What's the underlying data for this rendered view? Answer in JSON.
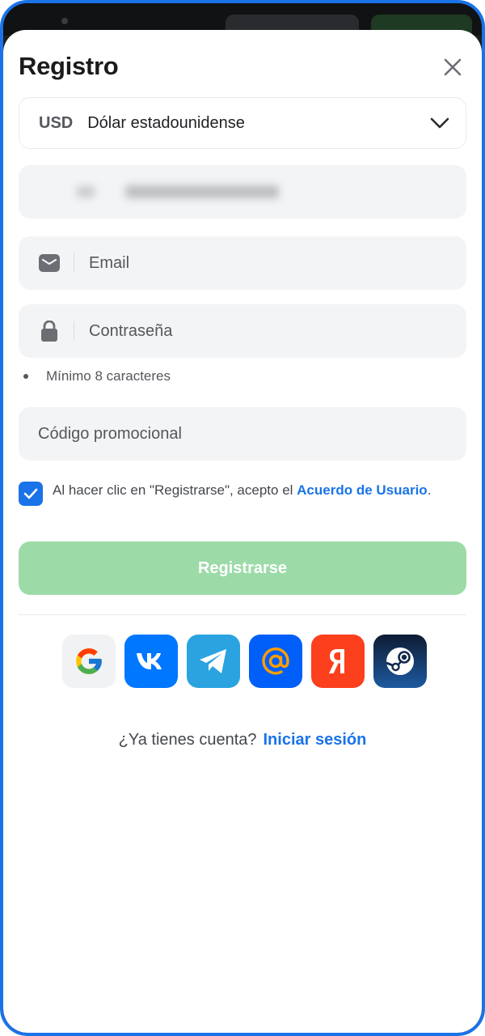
{
  "header": {
    "title": "Registro"
  },
  "currency": {
    "code": "USD",
    "name": "Dólar estadounidense"
  },
  "form": {
    "email_placeholder": "Email",
    "password_placeholder": "Contraseña",
    "password_hint": "Mínimo 8 caracteres",
    "promo_placeholder": "Código promocional"
  },
  "agreement": {
    "checked": true,
    "text": "Al hacer clic en \"Registrarse\", acepto el ",
    "link": "Acuerdo de Usuario",
    "suffix": "."
  },
  "register_button": "Registrarse",
  "social": [
    {
      "name": "google-icon",
      "color": "#f1f2f4"
    },
    {
      "name": "vk-icon",
      "color": "#0077ff"
    },
    {
      "name": "telegram-icon",
      "color": "#2aa3e0"
    },
    {
      "name": "mailru-icon",
      "color": "#005ff9"
    },
    {
      "name": "yandex-icon",
      "color": "#fc3f1d"
    },
    {
      "name": "steam-icon",
      "color": "#0d1f3c"
    }
  ],
  "login": {
    "question": "¿Ya tienes cuenta?",
    "link": "Iniciar sesión"
  },
  "colors": {
    "accent": "#1a73e8",
    "register_disabled": "#9cdba8",
    "field_bg": "#f3f4f5"
  }
}
